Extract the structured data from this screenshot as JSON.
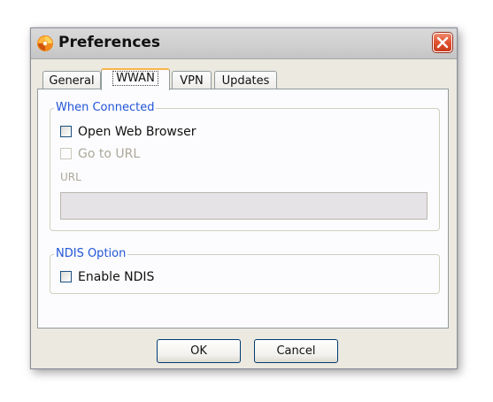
{
  "window": {
    "title": "Preferences",
    "app_icon": "app-logo-icon",
    "close_icon": "close-icon"
  },
  "tabs": [
    {
      "label": "General",
      "active": false
    },
    {
      "label": "WWAN",
      "active": true
    },
    {
      "label": "VPN",
      "active": false
    },
    {
      "label": "Updates",
      "active": false
    }
  ],
  "when_connected": {
    "legend": "When Connected",
    "open_web_browser": {
      "label": "Open Web Browser",
      "checked": false,
      "enabled": true
    },
    "go_to_url": {
      "label": "Go to URL",
      "checked": false,
      "enabled": false
    },
    "url_label": "URL",
    "url_value": ""
  },
  "ndis_option": {
    "legend": "NDIS Option",
    "enable_ndis": {
      "label": "Enable NDIS",
      "checked": false,
      "enabled": true
    }
  },
  "buttons": {
    "ok": "OK",
    "cancel": "Cancel"
  },
  "colors": {
    "legend_blue": "#2155d6",
    "close_red": "#e0512f",
    "active_tab_accent": "#f6b74a"
  }
}
